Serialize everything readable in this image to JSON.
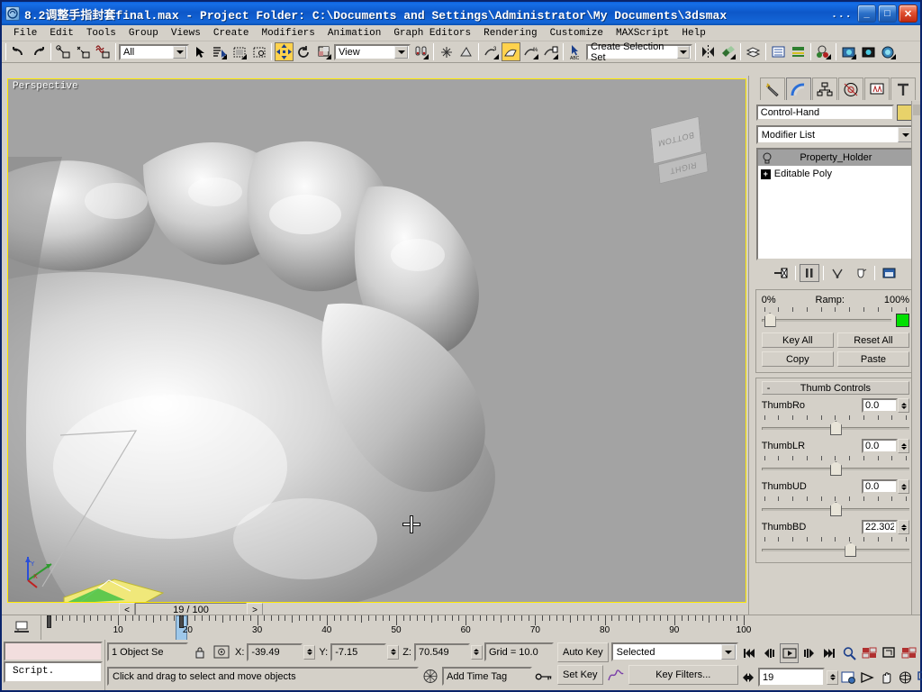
{
  "window": {
    "title": "8.2调整手指封套final.max     -  Project Folder: C:\\Documents and Settings\\Administrator\\My Documents\\3dsmax",
    "overflow_dots": "...",
    "app_icon": "3dsmax-icon",
    "buttons": {
      "minimize": "_",
      "maximize": "□",
      "close": "✕"
    }
  },
  "menubar": {
    "items": [
      {
        "label": "File"
      },
      {
        "label": "Edit"
      },
      {
        "label": "Tools"
      },
      {
        "label": "Group"
      },
      {
        "label": "Views"
      },
      {
        "label": "Create"
      },
      {
        "label": "Modifiers"
      },
      {
        "label": "Animation"
      },
      {
        "label": "Graph Editors"
      },
      {
        "label": "Rendering"
      },
      {
        "label": "Customize"
      },
      {
        "label": "MAXScript"
      },
      {
        "label": "Help"
      }
    ]
  },
  "toolbar": {
    "selection_filter": "All",
    "reference_coord": "View",
    "named_selection_set": "Create Selection Set",
    "icons": [
      "undo-icon",
      "redo-icon",
      "select-and-link-icon",
      "unlink-selection-icon",
      "bind-to-space-warp-icon",
      "select-object-icon",
      "select-by-name-icon",
      "rectangular-selection-region-icon",
      "window-crossing-icon",
      "select-and-move-icon",
      "select-and-rotate-icon",
      "select-and-uniform-scale-icon",
      "use-pivot-point-center-icon",
      "mirror-icon",
      "align-icon",
      "layer-manager-icon",
      "curve-editor-icon",
      "schematic-view-icon",
      "material-editor-icon",
      "render-scene-icon",
      "render-type-icon",
      "quick-render-icon",
      "snap-toggle-icon",
      "angle-snap-icon",
      "percent-snap-icon",
      "spinner-snap-icon",
      "named-selection-icon"
    ]
  },
  "viewport": {
    "label": "Perspective",
    "viewcube": {
      "top_face": "BOTTOM",
      "front_face": "RIGHT"
    },
    "axis_tripod": {
      "x": "X",
      "y": "Y",
      "z": "Z"
    },
    "cursor": "move-crosshair-cursor",
    "time_field": {
      "value": "19 / 100",
      "prev": "<",
      "next": ">"
    }
  },
  "command_panel": {
    "tabs": [
      {
        "name": "create-tab",
        "icon": "star-wand-icon",
        "selected": false
      },
      {
        "name": "modify-tab",
        "icon": "rainbow-arc-icon",
        "selected": true
      },
      {
        "name": "hierarchy-tab",
        "icon": "hierarchy-tree-icon",
        "selected": false
      },
      {
        "name": "motion-tab",
        "icon": "wheel-icon",
        "selected": false
      },
      {
        "name": "display-tab",
        "icon": "monitor-icon",
        "selected": false
      },
      {
        "name": "utilities-tab",
        "icon": "hammer-icon",
        "selected": false
      }
    ],
    "object_name": "Control-Hand",
    "object_color": "#e8d26a",
    "modifier_list_label": "Modifier List",
    "stack": [
      {
        "label": "Property_Holder",
        "selected": true,
        "icon": "light-bulb-icon"
      },
      {
        "label": "Editable Poly",
        "selected": false,
        "icon": "plus-box-icon"
      }
    ],
    "stack_buttons": [
      "pin-stack-icon",
      "show-end-result-icon",
      "make-unique-icon",
      "remove-modifier-icon",
      "configure-sets-icon"
    ],
    "ramp": {
      "min_label": "0%",
      "title": "Ramp:",
      "max_label": "100%",
      "value_percent": 2,
      "swatch_color": "#00e000",
      "buttons": [
        {
          "label": "Key All"
        },
        {
          "label": "Reset All"
        },
        {
          "label": "Copy"
        },
        {
          "label": "Paste"
        }
      ]
    },
    "thumb_controls": {
      "title": "Thumb Controls",
      "collapse": "-",
      "sliders": [
        {
          "label": "ThumbRo",
          "value": "0.0",
          "position_percent": 50
        },
        {
          "label": "ThumbLR",
          "value": "0.0",
          "position_percent": 50
        },
        {
          "label": "ThumbUD",
          "value": "0.0",
          "position_percent": 50
        },
        {
          "label": "ThumbBD",
          "value": "22.302",
          "position_percent": 60
        }
      ]
    }
  },
  "track_bar": {
    "icon": "open-mini-curve-editor-icon",
    "tick_labels": [
      "10",
      "20",
      "30",
      "40",
      "50",
      "60",
      "70",
      "80",
      "90",
      "100"
    ],
    "current_frame": 19,
    "key_at_frame": 0
  },
  "status_bar": {
    "listener_prompt": "Script.",
    "selection_count": "1 Object Se",
    "lock_icon": "selection-lock-icon",
    "absolute_mode_icon": "absolute-relative-transform-icon",
    "coords": [
      {
        "axis": "X:",
        "value": "-39.49"
      },
      {
        "axis": "Y:",
        "value": "-7.15"
      },
      {
        "axis": "Z:",
        "value": "70.549"
      }
    ],
    "grid": "Grid = 10.0",
    "add_time_tag": "Add Time Tag",
    "key_mode_icon": "key-mode-toggle-icon",
    "prompt": "Click and drag to select and move objects",
    "coord_display_icon": "isolate-selection-icon"
  },
  "animation_controls": {
    "auto_key": "Auto Key",
    "set_key": "Set Key",
    "key_filter_curve_icon": "parameter-curve-icon",
    "key_filters": "Key Filters...",
    "key_mode_selection": "Selected",
    "transport": [
      "go-to-start-icon",
      "previous-frame-icon",
      "play-animation-icon",
      "next-frame-icon",
      "go-to-end-icon"
    ],
    "key_mode_toggle_icon": "key-mode-toggle-icon",
    "current_frame_value": "19",
    "time_configuration_icon": "time-configuration-icon"
  },
  "viewport_navigation": {
    "buttons": [
      "zoom-icon",
      "zoom-all-icon",
      "zoom-extents-icon",
      "zoom-region-icon",
      "field-of-view-icon",
      "pan-icon",
      "arc-rotate-icon",
      "maximize-viewport-toggle-icon"
    ]
  }
}
